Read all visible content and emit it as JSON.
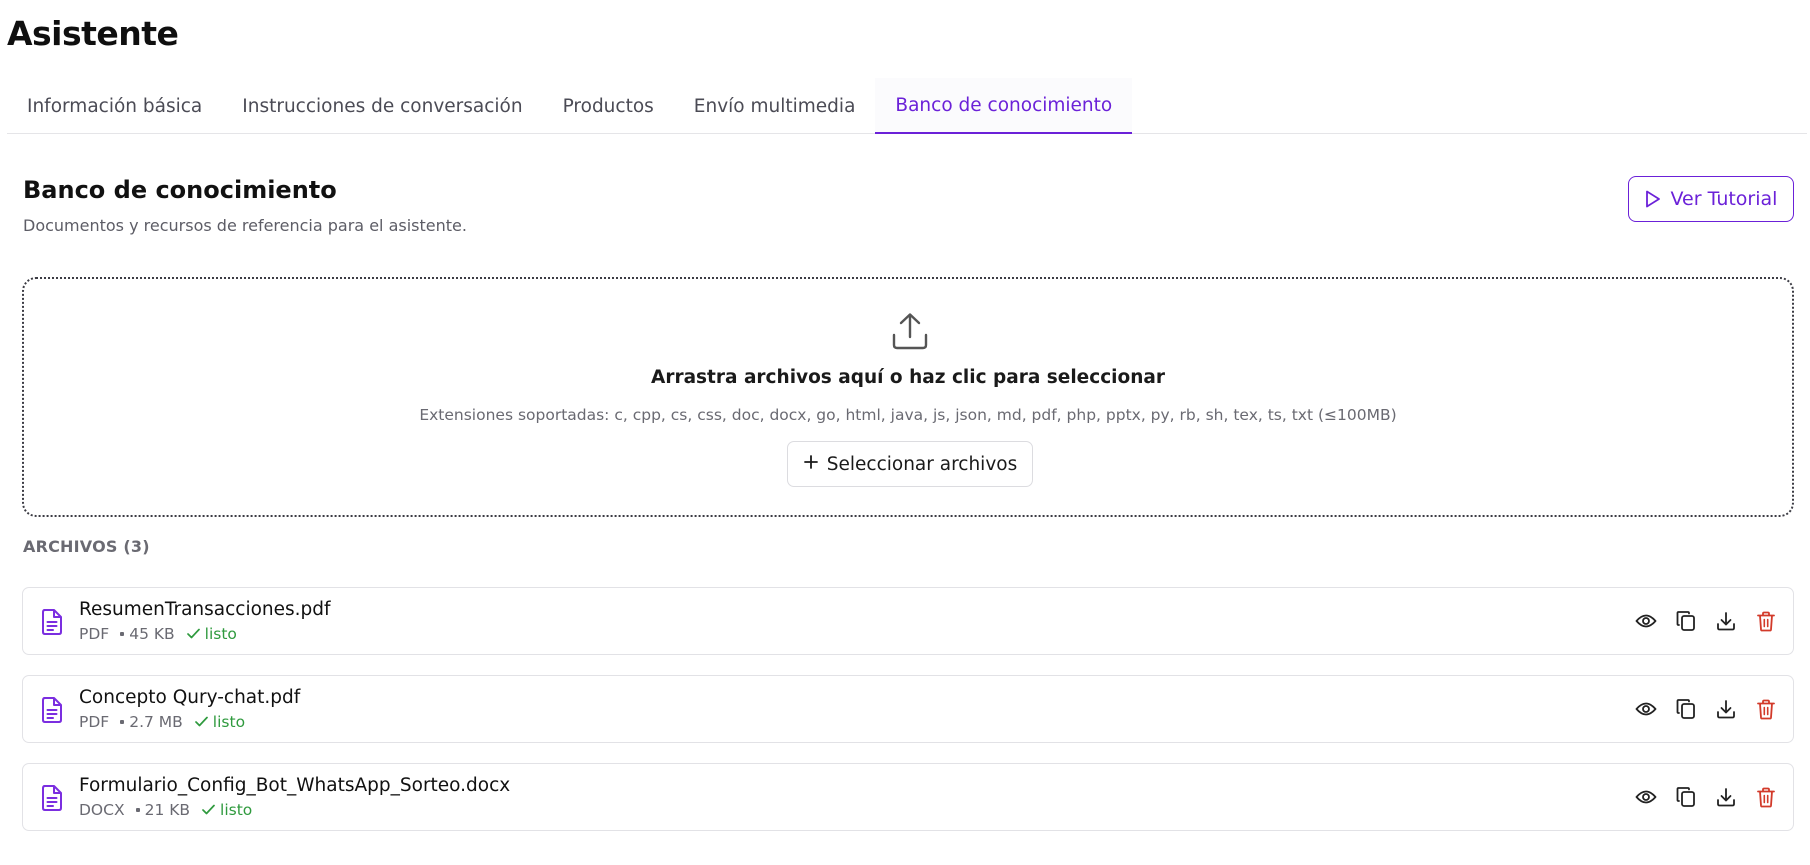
{
  "page": {
    "title": "Asistente"
  },
  "tabs": [
    {
      "label": "Información básica",
      "active": false
    },
    {
      "label": "Instrucciones de conversación",
      "active": false
    },
    {
      "label": "Productos",
      "active": false
    },
    {
      "label": "Envío multimedia",
      "active": false
    },
    {
      "label": "Banco de conocimiento",
      "active": true
    }
  ],
  "section": {
    "title": "Banco de conocimiento",
    "subtitle": "Documentos y recursos de referencia para el asistente.",
    "tutorial_label": "Ver Tutorial"
  },
  "dropzone": {
    "title": "Arrastra archivos aquí o haz clic para seleccionar",
    "extensions": "Extensiones soportadas: c, cpp, cs, css, doc, docx, go, html, java, js, json, md, pdf, php, pptx, py, rb, sh, tex, ts, txt (≤100MB)",
    "select_label": "Seleccionar archivos"
  },
  "files": {
    "header": "ARCHIVOS (3)",
    "items": [
      {
        "name": "ResumenTransacciones.pdf",
        "type": "PDF",
        "size": "45 KB",
        "status": "listo"
      },
      {
        "name": "Concepto Qury-chat.pdf",
        "type": "PDF",
        "size": "2.7 MB",
        "status": "listo"
      },
      {
        "name": "Formulario_Config_Bot_WhatsApp_Sorteo.docx",
        "type": "DOCX",
        "size": "21 KB",
        "status": "listo"
      }
    ]
  },
  "colors": {
    "accent": "#6b21d8",
    "success": "#2f9a3e",
    "danger": "#d23a2a"
  },
  "icons": {
    "tutorial": "play-icon",
    "upload": "upload-icon",
    "select": "plus-icon",
    "file": "file-document-icon",
    "status": "check-icon",
    "actions": [
      "eye-icon",
      "copy-icon",
      "download-icon",
      "trash-icon"
    ]
  }
}
